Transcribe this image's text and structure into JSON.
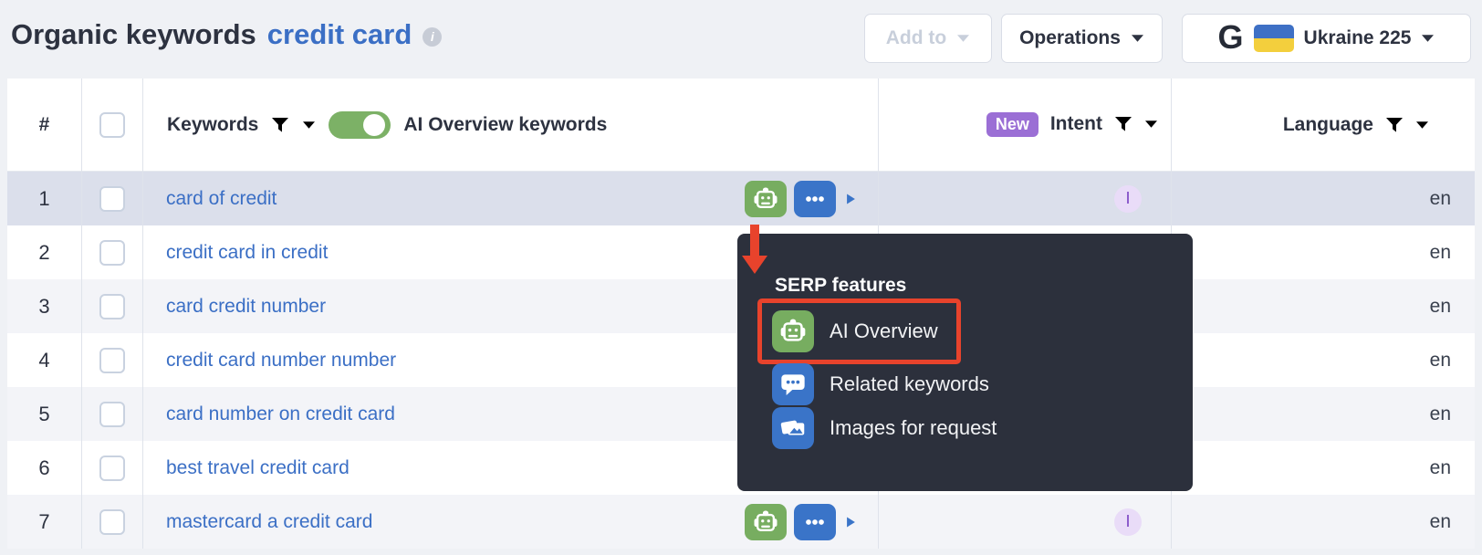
{
  "page": {
    "title": "Organic keywords",
    "title_query": "credit card"
  },
  "toolbar": {
    "add_to_label": "Add to",
    "operations_label": "Operations",
    "region_label": "Ukraine 225",
    "search_engine_icon": "google-logo",
    "region_flag_icon": "ukraine-flag"
  },
  "table": {
    "header": {
      "index_label": "#",
      "keywords_label": "Keywords",
      "ai_toggle_on": true,
      "ai_toggle_label": "AI Overview keywords",
      "new_badge": "New",
      "intent_label": "Intent",
      "language_label": "Language"
    },
    "rows": [
      {
        "num": "1",
        "keyword": "card of credit",
        "serp_features": true,
        "intent": "I",
        "language": "en",
        "selected": true
      },
      {
        "num": "2",
        "keyword": "credit card in credit",
        "serp_features": false,
        "intent": "",
        "language": "en",
        "selected": false
      },
      {
        "num": "3",
        "keyword": "card credit number",
        "serp_features": false,
        "intent": "",
        "language": "en",
        "selected": false
      },
      {
        "num": "4",
        "keyword": "credit card number number",
        "serp_features": false,
        "intent": "",
        "language": "en",
        "selected": false
      },
      {
        "num": "5",
        "keyword": "card number on credit card",
        "serp_features": false,
        "intent": "",
        "language": "en",
        "selected": false
      },
      {
        "num": "6",
        "keyword": "best travel credit card",
        "serp_features": false,
        "intent": "",
        "language": "en",
        "selected": false
      },
      {
        "num": "7",
        "keyword": "mastercard a credit card",
        "serp_features": true,
        "intent": "I",
        "language": "en",
        "selected": false
      }
    ]
  },
  "serp_tooltip": {
    "title": "SERP features",
    "items": [
      {
        "label": "AI Overview",
        "icon": "ai-overview-robot-icon",
        "highlighted": true
      },
      {
        "label": "Related keywords",
        "icon": "related-keywords-icon",
        "highlighted": false
      },
      {
        "label": "Images for request",
        "icon": "images-for-request-icon",
        "highlighted": false
      }
    ]
  },
  "colors": {
    "accent_green": "#77ad60",
    "accent_blue": "#3a74c8",
    "link_blue": "#3b6fc5",
    "highlight_red": "#e8432c",
    "badge_purple": "#9b6fd5",
    "intent_purple": "#7c46c4",
    "tooltip_bg": "#2c303c",
    "selected_row": "#dbdfeb"
  }
}
